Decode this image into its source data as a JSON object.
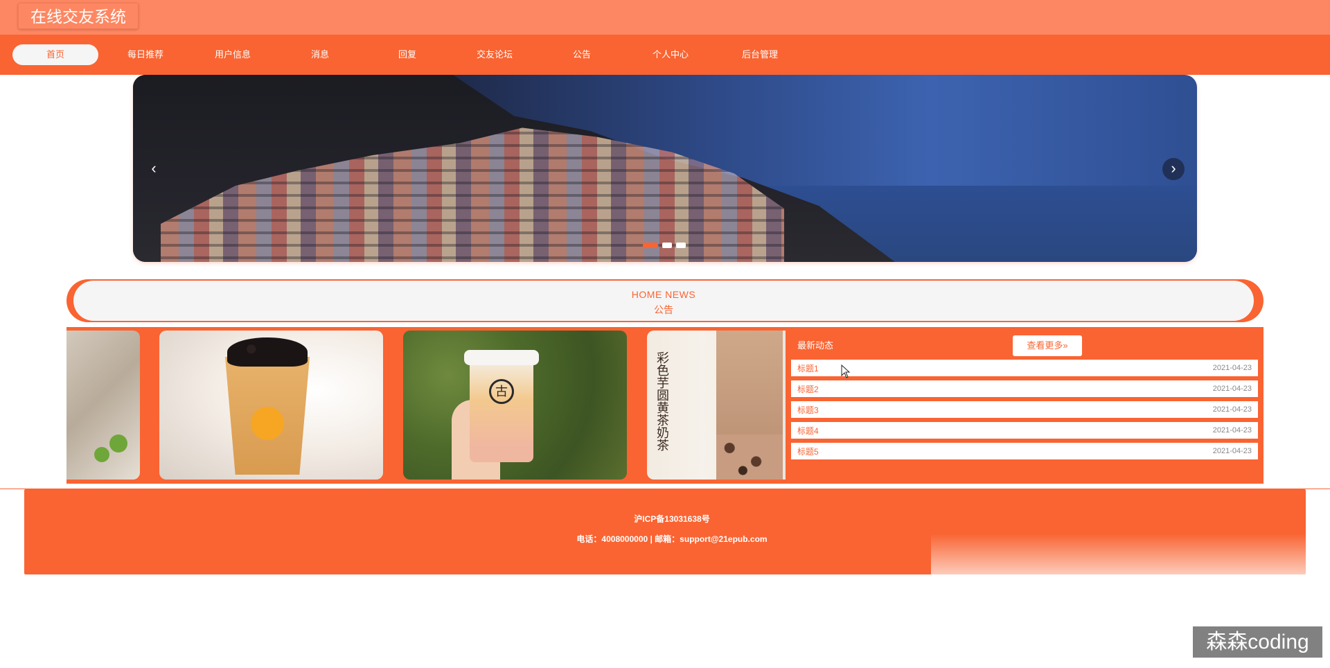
{
  "header": {
    "site_title": "在线交友系统"
  },
  "nav": {
    "items": [
      {
        "label": "首页",
        "active": true
      },
      {
        "label": "每日推荐",
        "active": false
      },
      {
        "label": "用户信息",
        "active": false
      },
      {
        "label": "消息",
        "active": false
      },
      {
        "label": "回复",
        "active": false
      },
      {
        "label": "交友论坛",
        "active": false
      },
      {
        "label": "公告",
        "active": false
      },
      {
        "label": "个人中心",
        "active": false
      },
      {
        "label": "后台管理",
        "active": false
      }
    ]
  },
  "banner": {
    "prev_icon": "chevron-left-icon",
    "next_icon": "chevron-right-icon",
    "slides": 3,
    "active_slide": 1
  },
  "news_section": {
    "title_en": "HOME NEWS",
    "title_cn": "公告"
  },
  "latest": {
    "title": "最新动态",
    "more_label": "查看更多»",
    "items": [
      {
        "title": "标题1",
        "date": "2021-04-23"
      },
      {
        "title": "标题2",
        "date": "2021-04-23"
      },
      {
        "title": "标题3",
        "date": "2021-04-23"
      },
      {
        "title": "标题4",
        "date": "2021-04-23"
      },
      {
        "title": "标题5",
        "date": "2021-04-23"
      }
    ]
  },
  "promo_images": {
    "vertical_text": "彩色芋圆黄茶奶茶",
    "cup_logo": "古"
  },
  "footer": {
    "icp": "沪ICP备13031638号",
    "contact": "电话：4008000000 | 邮箱：support@21epub.com"
  },
  "watermark": "森森coding",
  "colors": {
    "primary": "#f96432",
    "topbar": "#fd8762",
    "light_bg": "#f5f5f5"
  }
}
